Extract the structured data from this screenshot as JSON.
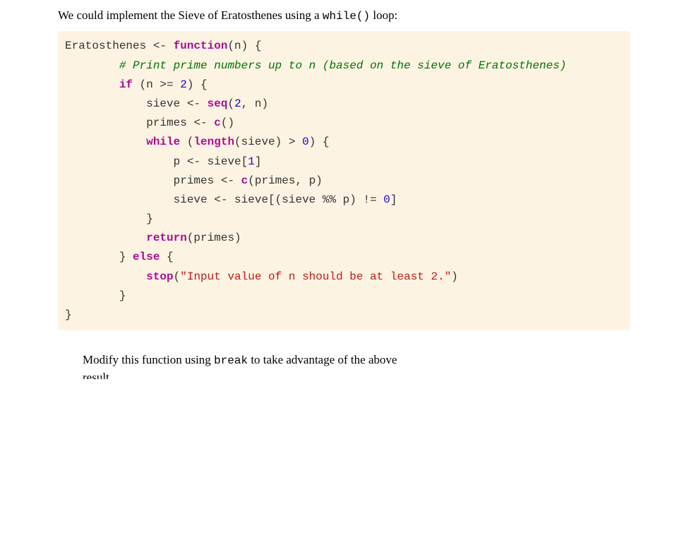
{
  "intro": {
    "text1": "We could implement the Sieve of Eratosthenes using a ",
    "code1": "while()",
    "text2": " loop:"
  },
  "code": {
    "l1_a": "Eratosthenes ",
    "l1_b": "<- ",
    "l1_c": "function",
    "l1_d": "(n) {",
    "l2_a": "        ",
    "l2_b": "# Print prime numbers up to n (based on the sieve of Eratosthenes)",
    "l3_a": "        ",
    "l3_b": "if",
    "l3_c": " (n ",
    "l3_d": ">=",
    "l3_e": " ",
    "l3_f": "2",
    "l3_g": ") {",
    "l4_a": "            sieve ",
    "l4_b": "<- ",
    "l4_c": "seq",
    "l4_d": "(",
    "l4_e": "2",
    "l4_f": ", n)",
    "l5_a": "            primes ",
    "l5_b": "<- ",
    "l5_c": "c",
    "l5_d": "()",
    "l6_a": "            ",
    "l6_b": "while",
    "l6_c": " (",
    "l6_d": "length",
    "l6_e": "(sieve) ",
    "l6_f": ">",
    "l6_g": " ",
    "l6_h": "0",
    "l6_i": ") {",
    "l7_a": "                p ",
    "l7_b": "<- ",
    "l7_c": "sieve[",
    "l7_d": "1",
    "l7_e": "]",
    "l8_a": "                primes ",
    "l8_b": "<- ",
    "l8_c": "c",
    "l8_d": "(primes, p)",
    "l9_a": "                sieve ",
    "l9_b": "<- ",
    "l9_c": "sieve[(sieve ",
    "l9_d": "%%",
    "l9_e": " p) ",
    "l9_f": "!=",
    "l9_g": " ",
    "l9_h": "0",
    "l9_i": "]",
    "l10": "            }",
    "l11_a": "            ",
    "l11_b": "return",
    "l11_c": "(primes)",
    "l12_a": "        } ",
    "l12_b": "else",
    "l12_c": " {",
    "l13_a": "            ",
    "l13_b": "stop",
    "l13_c": "(",
    "l13_d": "\"Input value of n should be at least 2.\"",
    "l13_e": ")",
    "l14": "        }",
    "l15": "}"
  },
  "instr": {
    "text1": "Modify this function using ",
    "code1": "break",
    "text2": " to take advantage of the above result",
    "cutoff": "result"
  }
}
